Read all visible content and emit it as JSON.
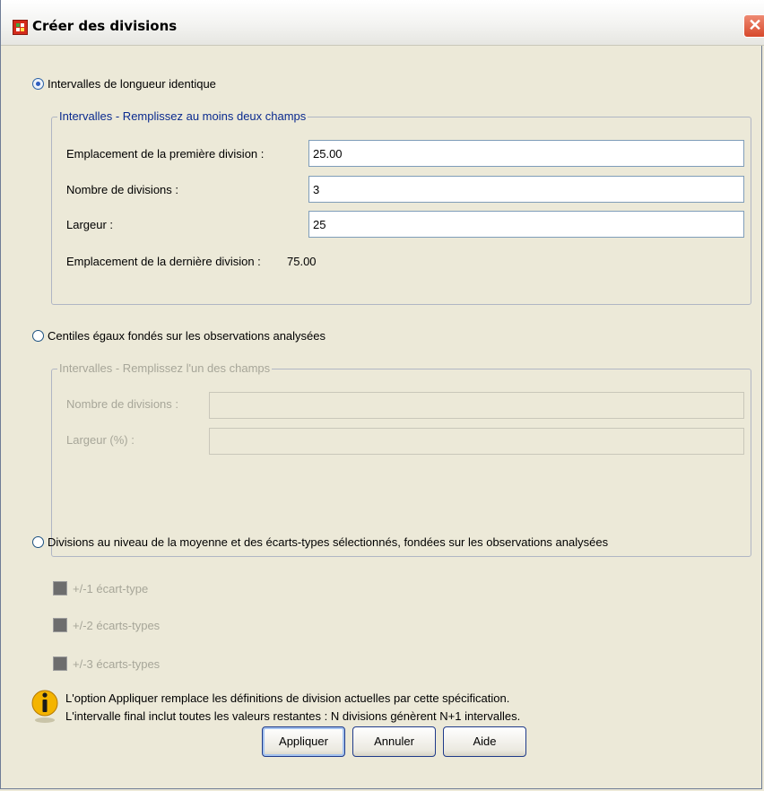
{
  "window": {
    "title": "Créer des divisions",
    "close_symbol": "✕"
  },
  "options": {
    "equal_width": {
      "label": "Intervalles de longueur identique",
      "selected": true,
      "group_legend": "Intervalles - Remplissez au moins deux champs",
      "first_location_label": "Emplacement de la première division :",
      "first_location_value": "25.00",
      "count_label": "Nombre de divisions :",
      "count_value": "3",
      "width_label": "Largeur :",
      "width_value": "25",
      "last_location_label": "Emplacement de la dernière division :",
      "last_location_value": "75.00"
    },
    "percentiles": {
      "label": "Centiles égaux fondés sur les observations analysées",
      "selected": false,
      "group_legend": "Intervalles - Remplissez l'un des champs",
      "count_label": "Nombre de divisions :",
      "count_value": "",
      "width_label": "Largeur (%) :",
      "width_value": ""
    },
    "std_dev": {
      "label": "Divisions au niveau de la moyenne et des écarts-types sélectionnés, fondées sur les observations analysées",
      "selected": false,
      "checkboxes": [
        {
          "label": "+/-1 écart-type",
          "checked": false
        },
        {
          "label": "+/-2 écarts-types",
          "checked": false
        },
        {
          "label": "+/-3 écarts-types",
          "checked": false
        }
      ]
    }
  },
  "info": {
    "icon": "info-icon",
    "line1": "L'option Appliquer remplace les définitions de division actuelles par cette spécification.",
    "line2": "L'intervalle final inclut toutes les valeurs restantes : N divisions génèrent N+1 intervalles."
  },
  "buttons": {
    "apply": "Appliquer",
    "cancel": "Annuler",
    "help": "Aide"
  },
  "colors": {
    "legend": "#0a2a8f",
    "disabled_text": "#a7a699",
    "close_button": "#d7492c"
  }
}
